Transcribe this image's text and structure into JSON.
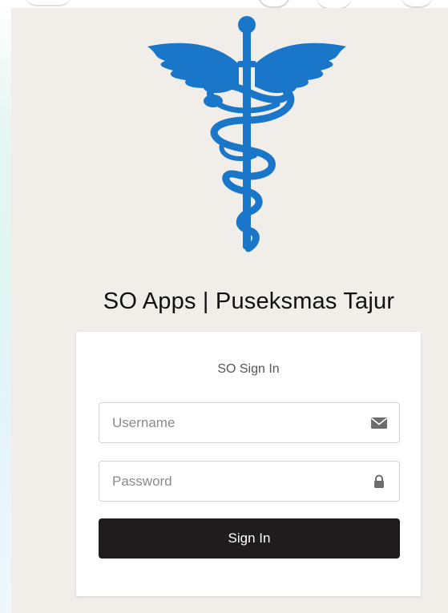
{
  "app_title": "SO Apps | Puseksmas Tajur",
  "logo": {
    "icon": "caduceus-icon",
    "color": "#1a76c9"
  },
  "login_card": {
    "title": "SO Sign In",
    "username": {
      "placeholder": "Username",
      "value": "",
      "icon": "envelope-icon"
    },
    "password": {
      "placeholder": "Password",
      "value": "",
      "icon": "lock-icon"
    },
    "submit_label": "Sign In"
  },
  "colors": {
    "primary_blue": "#1a76c9",
    "button_dark": "#1f1c1d",
    "panel_bg": "#f1eee9",
    "card_bg": "#ffffff"
  }
}
